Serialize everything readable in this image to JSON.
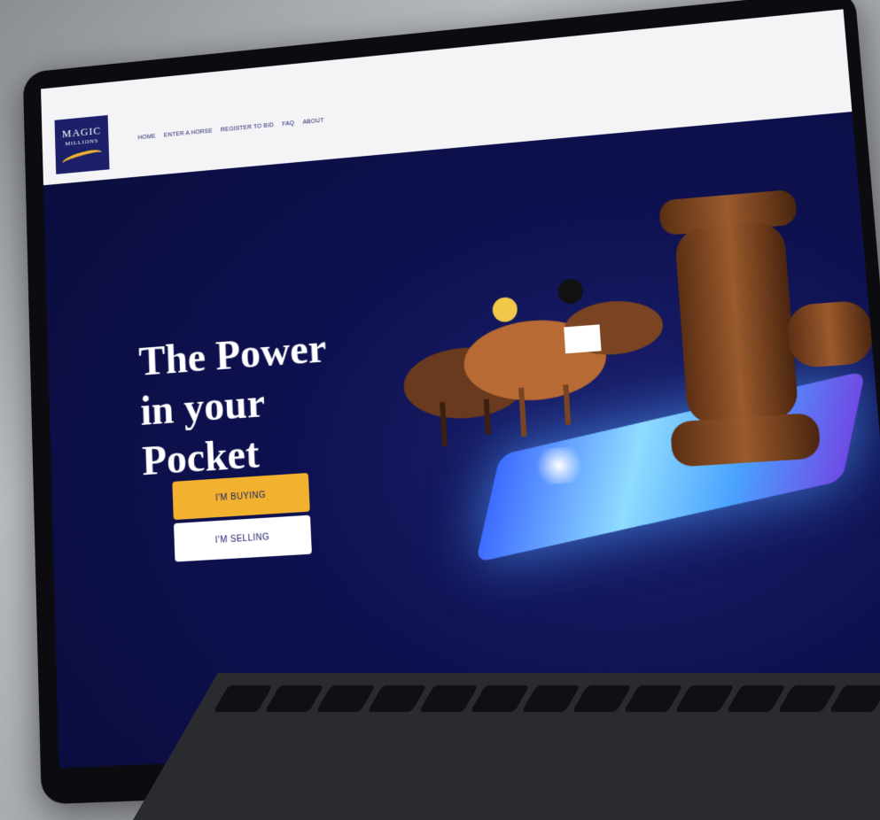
{
  "header": {
    "logo": {
      "line1": "MAGIC",
      "line2": "MILLIONS"
    },
    "nav": [
      {
        "label": "HOME"
      },
      {
        "label": "ENTER A HORSE"
      },
      {
        "label": "REGISTER TO BID"
      },
      {
        "label": "FAQ"
      },
      {
        "label": "ABOUT"
      }
    ]
  },
  "hero": {
    "title_line1": "The Power",
    "title_line2": "in your",
    "title_line3": "Pocket",
    "buy_label": "I'M BUYING",
    "sell_label": "I'M SELLING"
  },
  "keyboard": {
    "keys": [
      "",
      "",
      "",
      "",
      "",
      "",
      "",
      "",
      "",
      "",
      "",
      "",
      "",
      ""
    ]
  },
  "colors": {
    "brand_navy": "#1b2068",
    "accent_gold": "#f2b22f",
    "hero_bg": "#0e1150"
  }
}
